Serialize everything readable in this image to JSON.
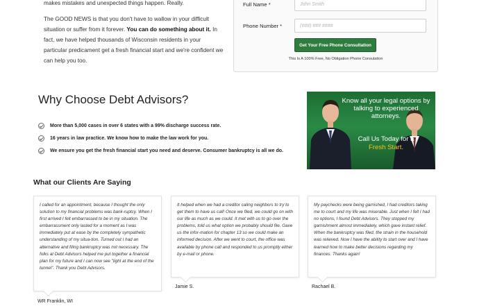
{
  "intro": {
    "line0": "makes mistakes and unexpected things happen. Really.",
    "p1": "The GOOD NEWS is that you don't have to wallow in your difficult situation or suffer from it forever. ",
    "p1_bold": "You can do something about it.",
    "p1_rest": " In fact, we have helped thousands of Wisconsin residents in your particular predicament get a fresh financial start and we're confident we can help you too."
  },
  "form": {
    "full_name_label": "Full Name *",
    "full_name_placeholder": "John Smith",
    "phone_label": "Phone Number *",
    "phone_placeholder": "(###) ### ####",
    "submit_label": "Get Your Free Phone Consultation",
    "disclaimer": "This Is A 100% Free, No Obligation Phone Consulation"
  },
  "why": {
    "title": "Why Choose Debt Advisors?",
    "benefits": [
      "More than 5,000 cases in over 6 states with a 99% discharge success rate.",
      "16 years in law practice. We know how to make the law work for you.",
      "We ensure you get the fresh financial start you need and deserve. Consumer bankruptcy is all we do."
    ]
  },
  "ad": {
    "line1": "Know all your legal options by talking to experienced attorneys.",
    "line2": "Call Us Today for a",
    "line3": "Fresh Start.",
    "accent": "#f3c31d",
    "background": "#2a8a45"
  },
  "clients": {
    "title": "What our Clients Are Saying",
    "testimonials": [
      {
        "text": "I called for an appointment, because I thought the only solution to my financial problems was bank-ruptcy. When I first arrived I felt embarrassed to be in my situation. The embarrassment only lasted for a moment as I was immediately put at ease by the completely sympathetic understanding of my situa-tion. Turned out I had an alternative and filing bankruptcy was not necessary. The folks at Debt Advisors helped me put together a financial plan for my future and I can now see \"light at the end of the tunnel\". Thank you Debt Advisors.",
        "author": "WR Franklin, WI"
      },
      {
        "text": "It helped when we had a creditor caling neighbors to try to get them to have us call! Once we filed, we could go on with our life as much as we could. It met with us to go over the problems, told us what option we probably should file. Gave us the infor-mation for chapter 13 so we could make an informed decision. After we went to court, the office was available by phone call and responded to us promptly either by e-mail or phone.",
        "author": "Jamie S."
      },
      {
        "text": "My paychecks were being garnished, I had creditors taking me to court and my life was miserable. Just when I felt I had no options, I found Debt Advisors. They stopped my garnishment almost immediately, which gave instant relief. When the bankruptcy was filed, the strain in the household was relieved.  Now I have the ability to start over and I have learned how to make better decisions regarding my finances. Thanks again!",
        "author": "Rachael B."
      }
    ]
  }
}
